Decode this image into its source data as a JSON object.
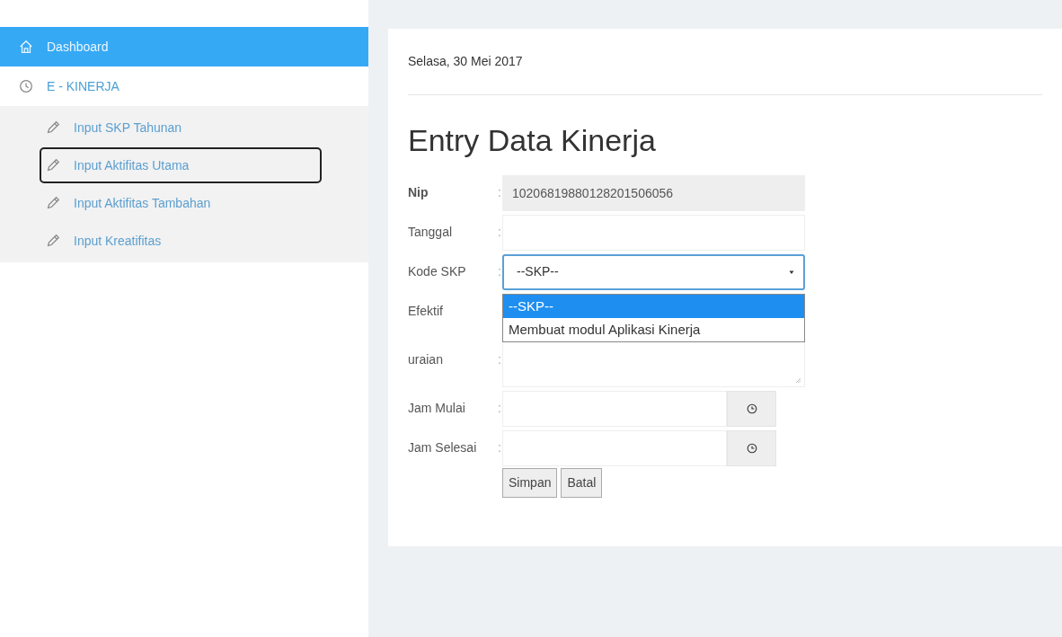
{
  "sidebar": {
    "items": [
      {
        "label": "Dashboard",
        "kind": "link",
        "selected": true
      },
      {
        "label": "E - KINERJA",
        "kind": "group",
        "selected": false,
        "expanded": true,
        "children": [
          {
            "label": "Input SKP Tahunan",
            "focused": false
          },
          {
            "label": "Input Aktifitas Utama",
            "focused": true
          },
          {
            "label": "Input Aktifitas Tambahan",
            "focused": false
          },
          {
            "label": "Input Kreatifitas",
            "focused": false
          }
        ]
      }
    ]
  },
  "date": "Selasa, 30 Mei 2017",
  "heading": "Entry Data Kinerja",
  "form": {
    "fields": [
      {
        "kind": "text",
        "label": "Nip",
        "separator": ":",
        "value": "10206819880128201506056",
        "readonly": true
      },
      {
        "kind": "text",
        "label": "Tanggal",
        "separator": ":",
        "readonly": false
      },
      {
        "kind": "select",
        "label": "Kode SKP",
        "separator": ":",
        "value": "--SKP--",
        "open": true,
        "options": [
          {
            "label": "--SKP--",
            "selected": true
          },
          {
            "label": "Membuat modul Aplikasi Kinerja",
            "selected": false
          }
        ]
      },
      {
        "kind": "hidden",
        "label": "Efektif"
      },
      {
        "kind": "textarea",
        "label": "uraian",
        "separator": ":"
      },
      {
        "kind": "time",
        "label": "Jam Mulai",
        "separator": ":"
      },
      {
        "kind": "time",
        "label": "Jam Selesai",
        "separator": ":"
      }
    ],
    "buttons": [
      "Simpan",
      "Batal"
    ]
  }
}
